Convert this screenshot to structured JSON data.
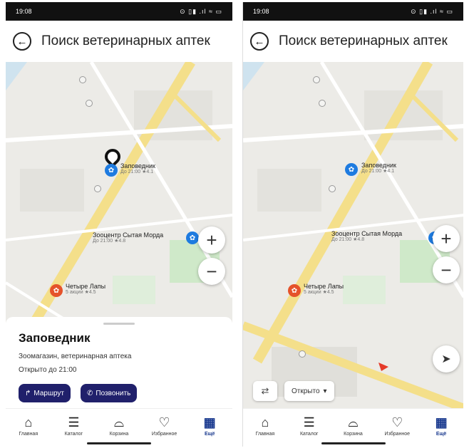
{
  "left": {
    "status": {
      "time": "19:08",
      "icons": "⊙ ▯▮ .ıl ≈ ▭"
    },
    "title": "Поиск ветеринарных аптек",
    "map": {
      "markers": [
        {
          "name": "Заповедник",
          "sub": "До 21:00 ★4.1"
        },
        {
          "name": "Зооцентр Сытая Морда",
          "sub": "До 21:00 ★4.8"
        },
        {
          "name": "Четыре Лапы",
          "sub": "5 акции ★4.5"
        }
      ],
      "zoom_in": "+",
      "zoom_out": "−"
    },
    "sheet": {
      "title": "Заповедник",
      "desc": "Зоомагазин, ветеринарная аптека",
      "hours": "Открыто до 21:00",
      "route_label": "Маршрут",
      "call_label": "Позвонить"
    },
    "tabs": [
      {
        "icon": "home-icon",
        "label": "Главная"
      },
      {
        "icon": "catalog-icon",
        "label": "Каталог"
      },
      {
        "icon": "cart-icon",
        "label": "Корзина"
      },
      {
        "icon": "heart-icon",
        "label": "Избранное"
      },
      {
        "icon": "grid-icon",
        "label": "Ещё"
      }
    ]
  },
  "right": {
    "status": {
      "time": "19:08",
      "icons": "⊙ ▯▮ .ıl ≈ ▭"
    },
    "title": "Поиск ветеринарных аптек",
    "map": {
      "markers": [
        {
          "name": "Заповедник",
          "sub": "До 21:00 ★4.1"
        },
        {
          "name": "Зооцентр Сытая Морда",
          "sub": "До 21:00 ★4.8"
        },
        {
          "name": "Четыре Лапы",
          "sub": "5 акции ★4.5"
        }
      ],
      "zoom_in": "+",
      "zoom_out": "−",
      "filter_chip": "Открыто"
    },
    "tabs": [
      {
        "icon": "home-icon",
        "label": "Главная"
      },
      {
        "icon": "catalog-icon",
        "label": "Каталог"
      },
      {
        "icon": "cart-icon",
        "label": "Корзина"
      },
      {
        "icon": "heart-icon",
        "label": "Избранное"
      },
      {
        "icon": "grid-icon",
        "label": "Ещё"
      }
    ]
  },
  "colors": {
    "accent": "#20206b",
    "active_tab": "#1a3a8f",
    "pin_blue": "#1e7be0",
    "pin_orange": "#e5522a",
    "road": "#f4df8a"
  }
}
